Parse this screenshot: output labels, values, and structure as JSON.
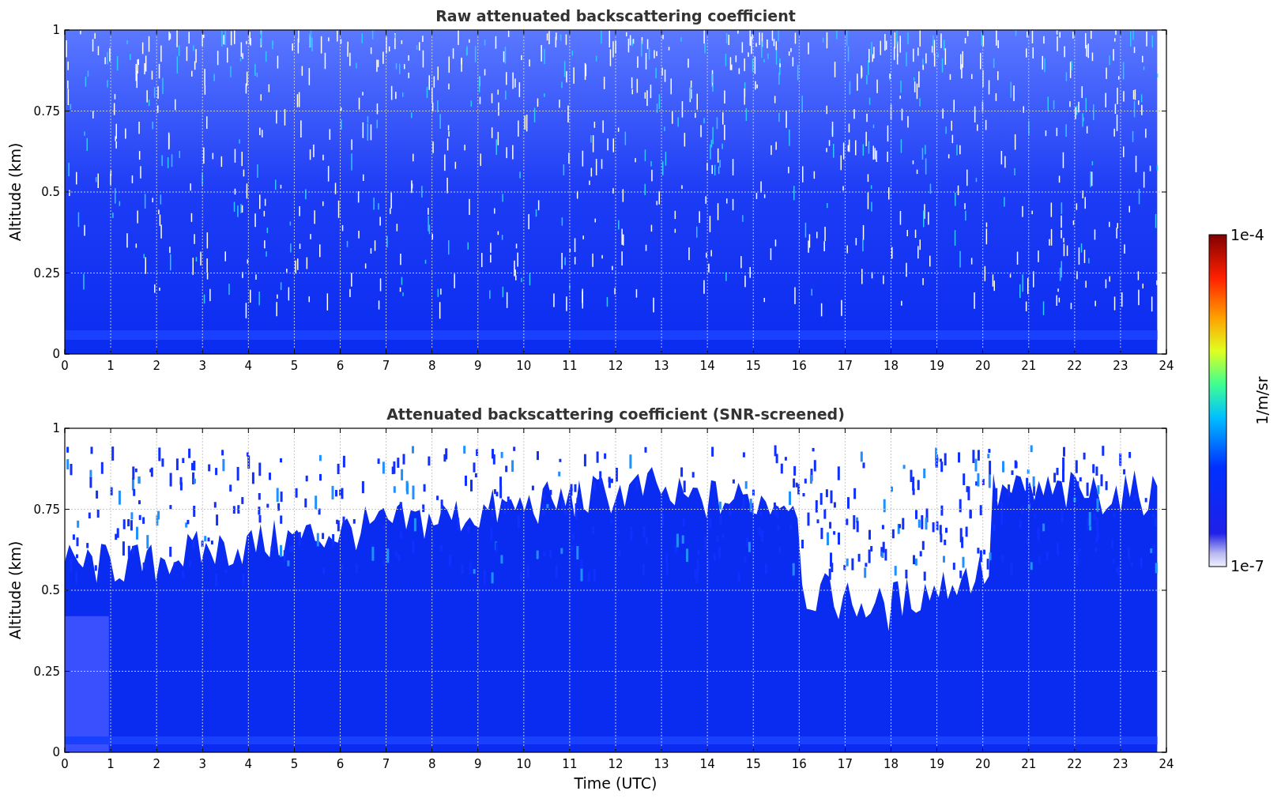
{
  "plots": [
    {
      "title": "Raw attenuated backscattering coefficient",
      "ylabel": "Altitude (km)",
      "kind": "raw",
      "yticks": [
        "1",
        "0.75",
        "0.5",
        "0.25",
        "0"
      ],
      "xticks": [
        "0",
        "1",
        "2",
        "3",
        "4",
        "5",
        "6",
        "7",
        "8",
        "9",
        "10",
        "11",
        "12",
        "13",
        "14",
        "15",
        "16",
        "17",
        "18",
        "19",
        "20",
        "21",
        "22",
        "23",
        "24"
      ]
    },
    {
      "title": "Attenuated backscattering coefficient (SNR-screened)",
      "ylabel": "Altitude (km)",
      "xlabel": "Time (UTC)",
      "kind": "screened",
      "yticks": [
        "1",
        "0.75",
        "0.5",
        "0.25",
        "0"
      ],
      "xticks": [
        "0",
        "1",
        "2",
        "3",
        "4",
        "5",
        "6",
        "7",
        "8",
        "9",
        "10",
        "11",
        "12",
        "13",
        "14",
        "15",
        "16",
        "17",
        "18",
        "19",
        "20",
        "21",
        "22",
        "23",
        "24"
      ]
    }
  ],
  "colorbar": {
    "label": "1/m/sr",
    "max_label": "1e-4",
    "min_label": "1e-7"
  }
}
